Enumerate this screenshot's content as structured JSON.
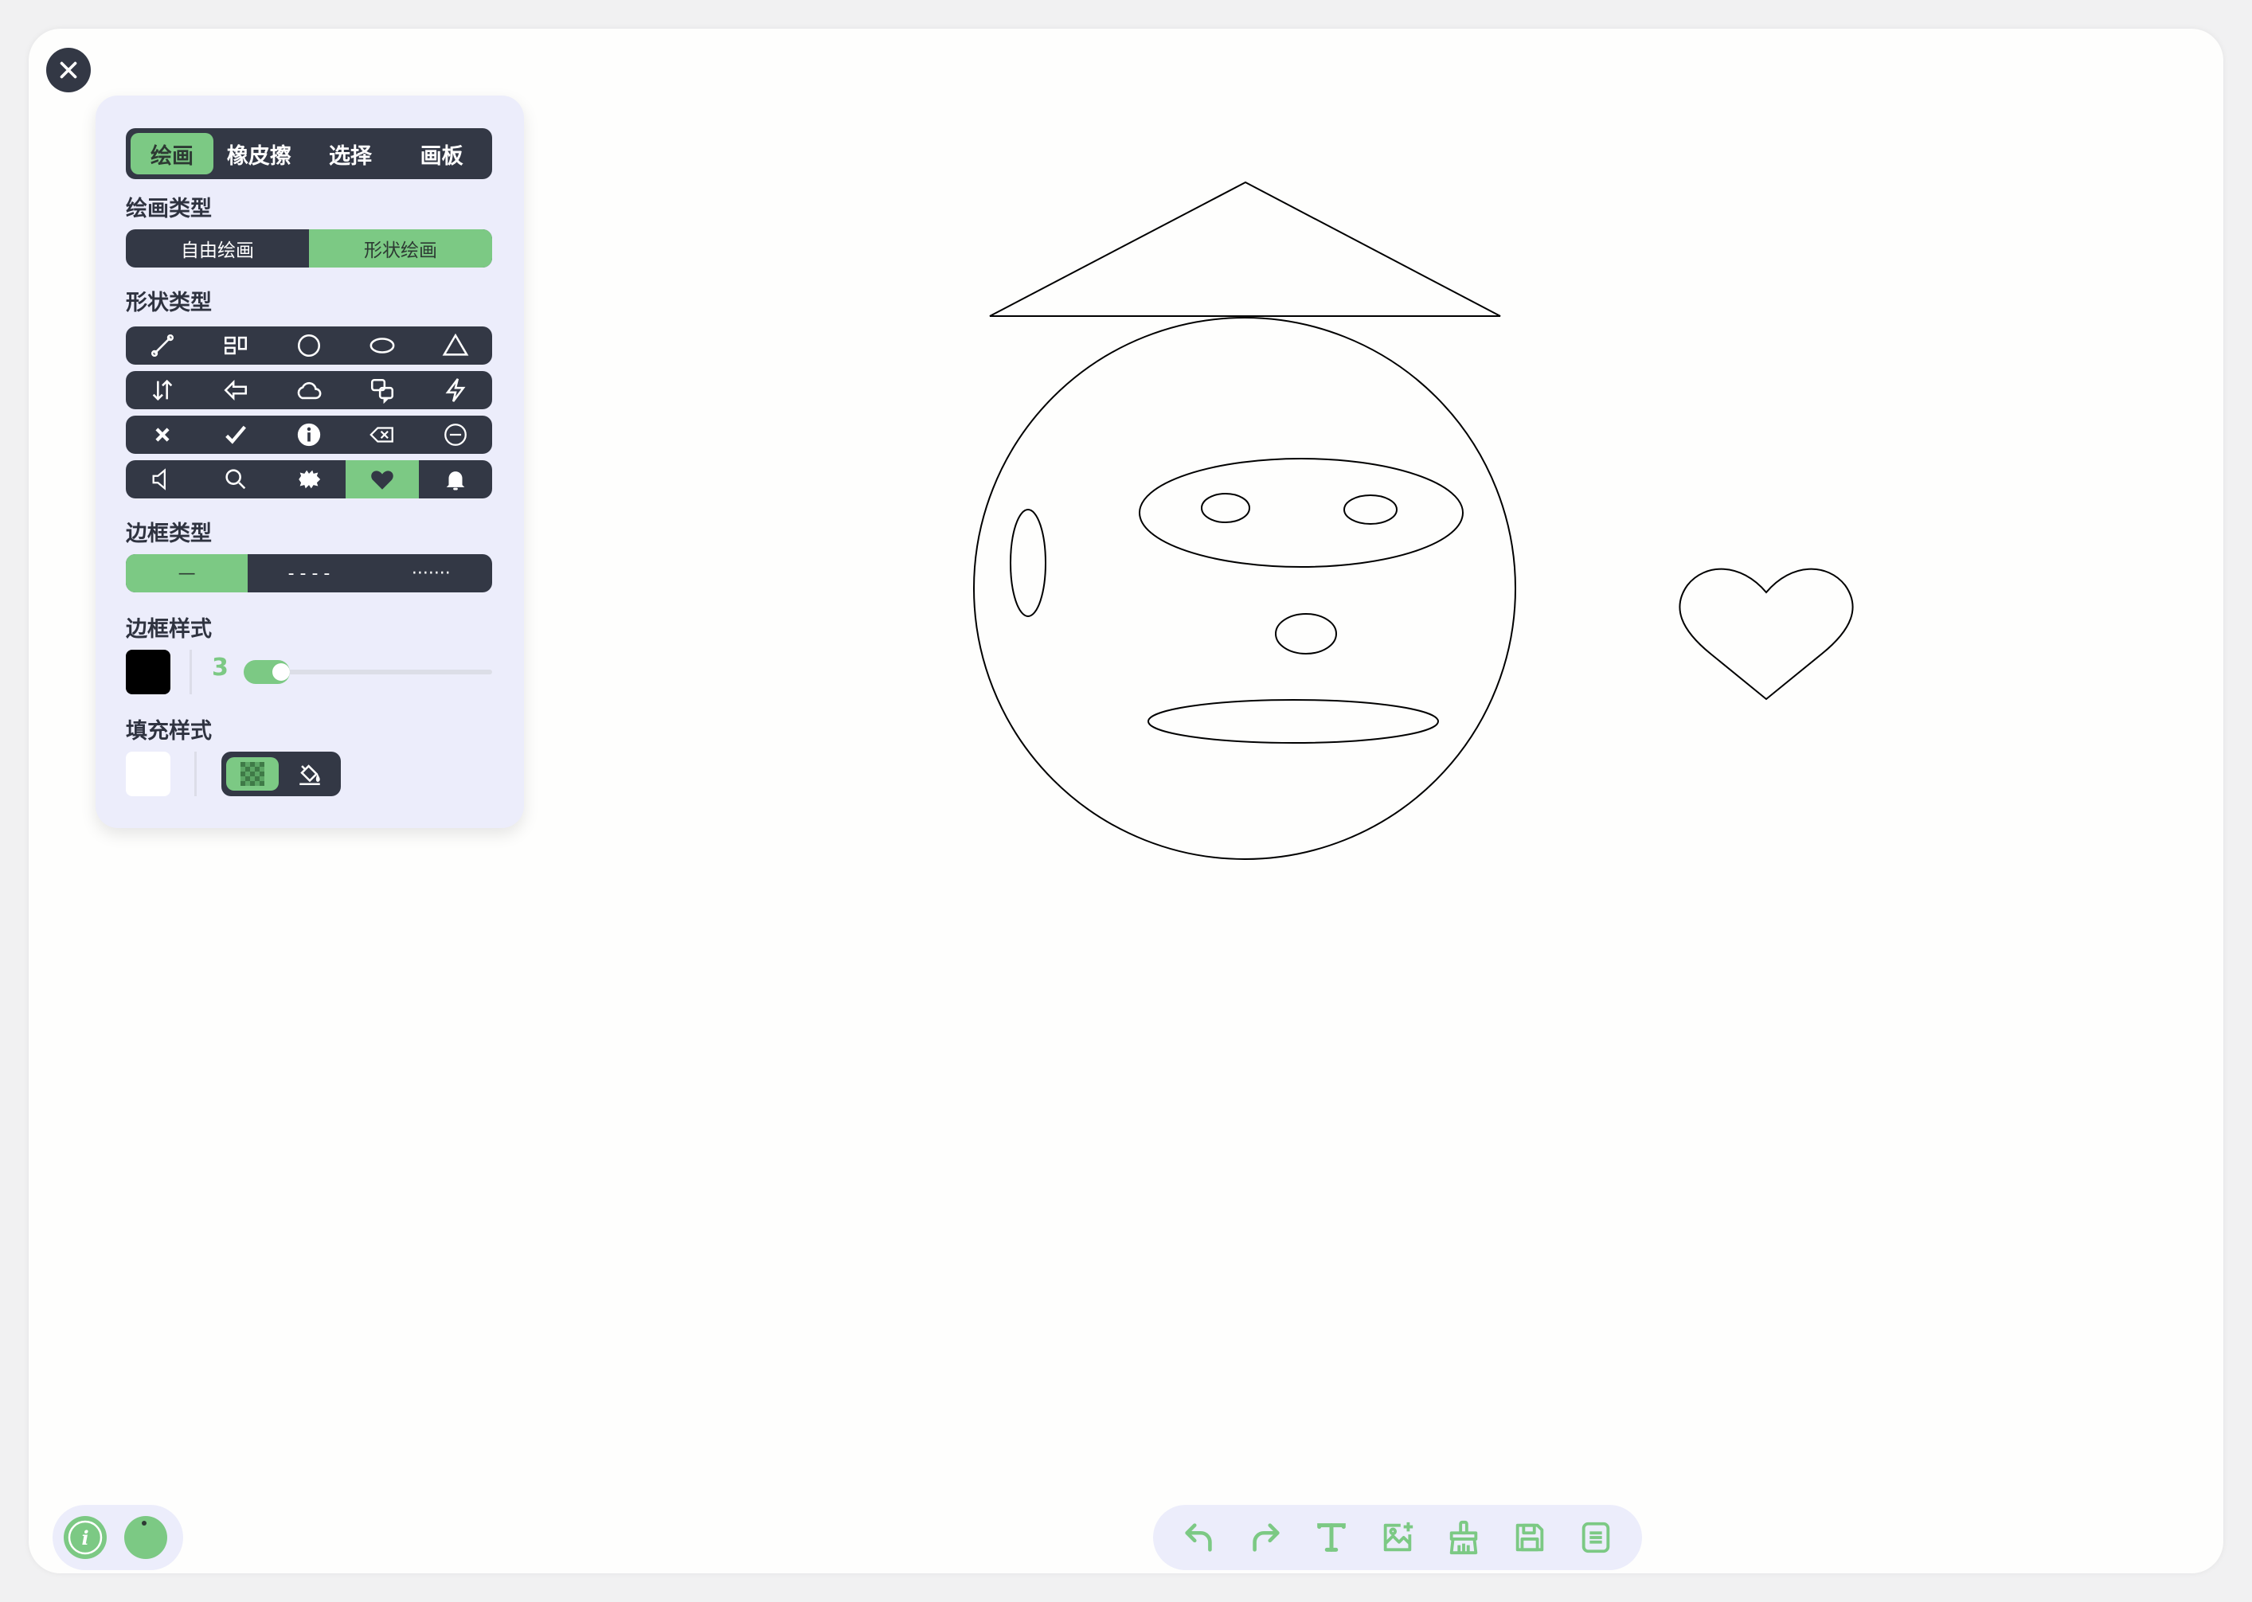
{
  "panel": {
    "tabs": [
      {
        "label": "绘画",
        "active": true
      },
      {
        "label": "橡皮擦",
        "active": false
      },
      {
        "label": "选择",
        "active": false
      },
      {
        "label": "画板",
        "active": false
      }
    ],
    "draw_type_label": "绘画类型",
    "draw_types": [
      {
        "label": "自由绘画",
        "active": false
      },
      {
        "label": "形状绘画",
        "active": true
      }
    ],
    "shape_type_label": "形状类型",
    "shapes": [
      [
        "line-icon",
        "rect-icon",
        "circle-icon",
        "ellipse-icon",
        "triangle-icon"
      ],
      [
        "arrows-icon",
        "arrow-left-icon",
        "cloud-icon",
        "callout-icon",
        "lightning-icon"
      ],
      [
        "cross-icon",
        "check-icon",
        "info-icon",
        "backspace-icon",
        "minus-circle-icon"
      ],
      [
        "speaker-icon",
        "search-icon",
        "cloud-badge-icon",
        "heart-icon",
        "bell-icon"
      ]
    ],
    "active_shape": "heart-icon",
    "border_type_label": "边框类型",
    "border_types": [
      {
        "label": "—",
        "active": true
      },
      {
        "label": "- - - -",
        "active": false
      },
      {
        "label": "·······",
        "active": false
      }
    ],
    "border_style_label": "边框样式",
    "border_color": "#000000",
    "border_width": "3",
    "fill_style_label": "填充样式",
    "fill_color": "#ffffff"
  },
  "colors": {
    "accent": "#7cc984",
    "dark": "#333845",
    "panel_bg": "#ecedfb"
  },
  "bottom_left": {
    "buttons": [
      "info-icon",
      "ball-icon"
    ]
  },
  "toolbar": {
    "buttons": [
      "undo-icon",
      "redo-icon",
      "text-icon",
      "image-add-icon",
      "clear-icon",
      "save-icon",
      "menu-icon"
    ]
  }
}
